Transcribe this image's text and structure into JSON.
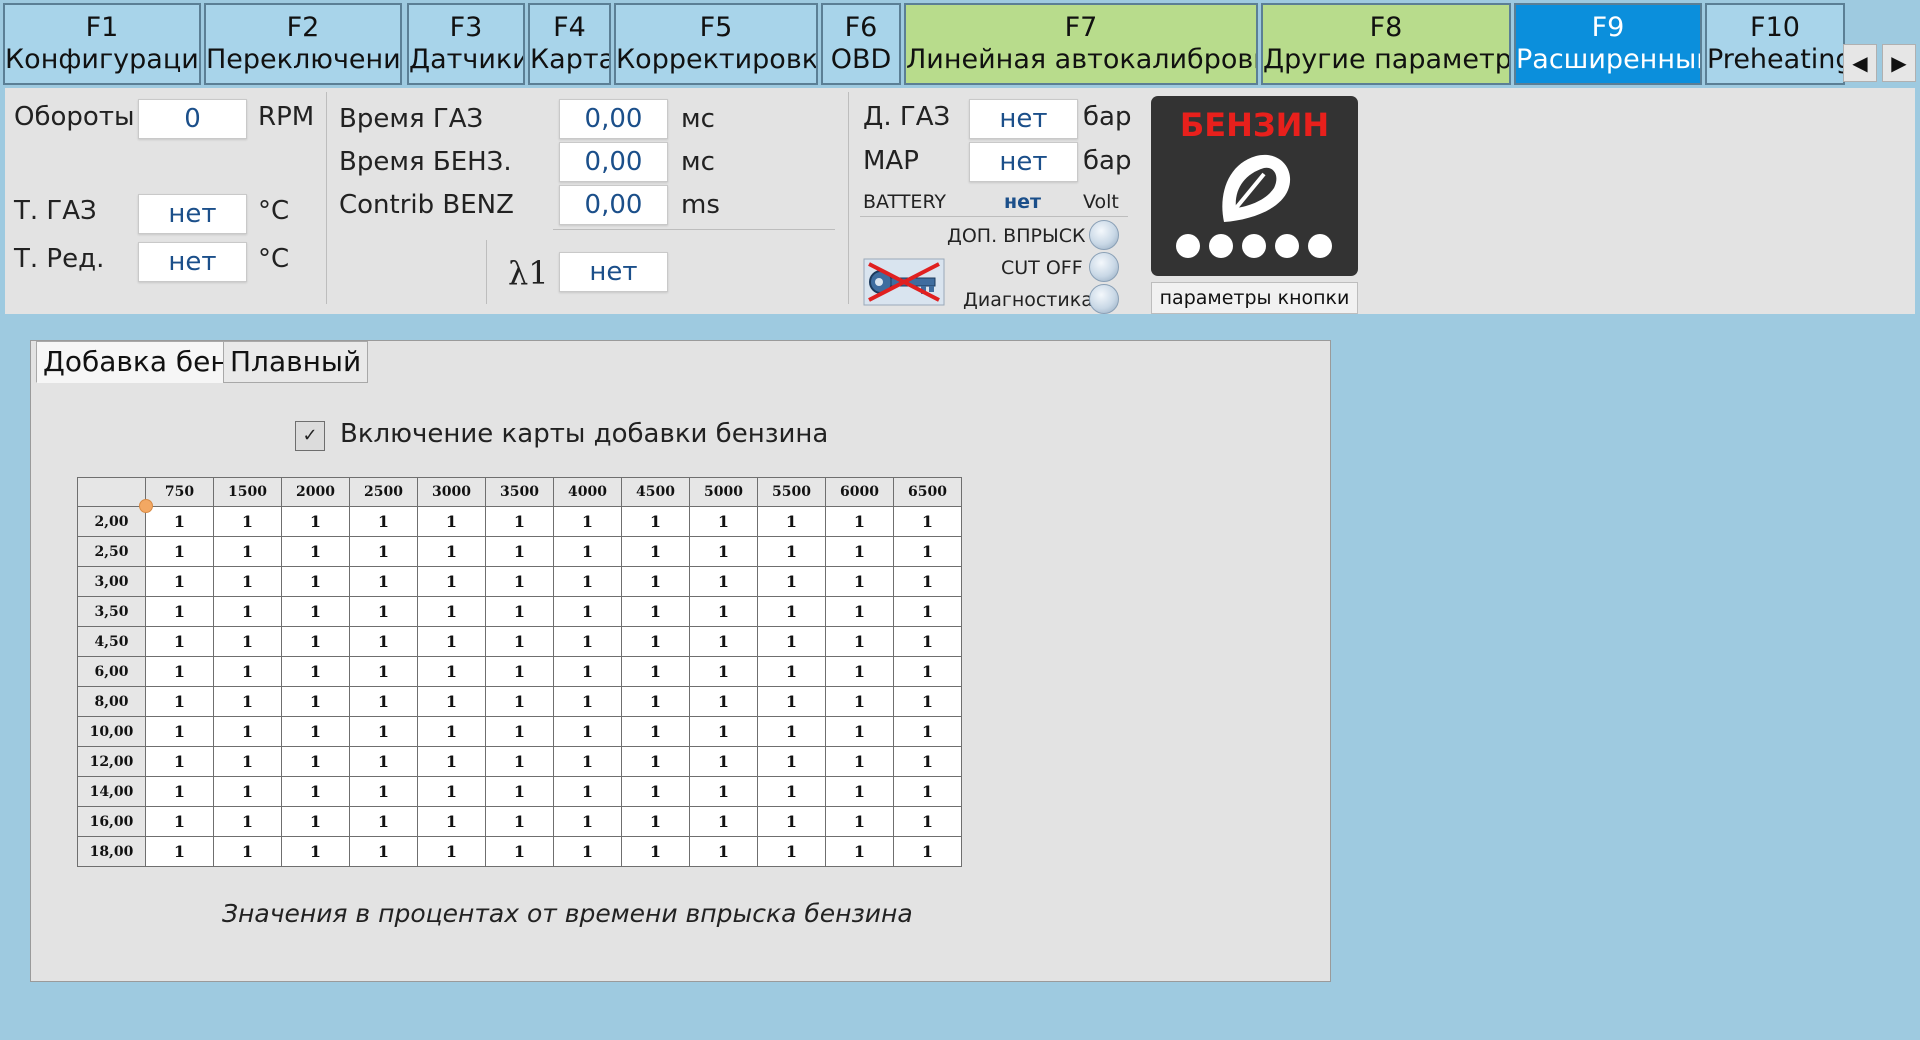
{
  "tabs": [
    {
      "key": "F1",
      "label": "Конфигурация"
    },
    {
      "key": "F2",
      "label": "Переключение"
    },
    {
      "key": "F3",
      "label": "Датчики"
    },
    {
      "key": "F4",
      "label": "Карта"
    },
    {
      "key": "F5",
      "label": "Корректировка"
    },
    {
      "key": "F6",
      "label": "OBD"
    },
    {
      "key": "F7",
      "label": "Линейная автокалибровка"
    },
    {
      "key": "F8",
      "label": "Другие параметры"
    },
    {
      "key": "F9",
      "label": "Расширенный"
    },
    {
      "key": "F10",
      "label": "Preheating"
    }
  ],
  "scroll": {
    "left": "◀",
    "right": "▶"
  },
  "status": {
    "rpm_label": "Обороты",
    "rpm_value": "0",
    "rpm_unit": "RPM",
    "tgas_label": "Т. ГАЗ",
    "tgas_value": "нет",
    "tgas_unit": "°C",
    "tred_label": "Т. Ред.",
    "tred_value": "нет",
    "tred_unit": "°C",
    "gas_time_label": "Время ГАЗ",
    "gas_time_value": "0,00",
    "gas_time_unit": "мс",
    "benz_time_label": "Время БЕНЗ.",
    "benz_time_value": "0,00",
    "benz_time_unit": "мс",
    "contrib_label": "Contrib BENZ",
    "contrib_value": "0,00",
    "contrib_unit": "ms",
    "lambda_label": "λ1",
    "lambda_value": "нет",
    "dgas_label": "Д. ГАЗ",
    "dgas_value": "нет",
    "dgas_unit": "бар",
    "map_label": "MAP",
    "map_value": "нет",
    "map_unit": "бар",
    "battery_label": "BATTERY",
    "battery_value": "нет",
    "battery_unit": "Volt",
    "extra_inj_label": "ДОП. ВПРЫСК",
    "cutoff_label": "CUT OFF",
    "diag_label": "Диагностика"
  },
  "fuel_button": {
    "title": "БЕНЗИН",
    "params_label": "параметры кнопки"
  },
  "subtabs": [
    "Добавка бенз",
    "Плавный"
  ],
  "map_enable": {
    "label": "Включение карты добавки бензина",
    "checked": true,
    "mark": "✓"
  },
  "grid": {
    "columns": [
      "750",
      "1500",
      "2000",
      "2500",
      "3000",
      "3500",
      "4000",
      "4500",
      "5000",
      "5500",
      "6000",
      "6500"
    ],
    "rows": [
      "2,00",
      "2,50",
      "3,00",
      "3,50",
      "4,50",
      "6,00",
      "8,00",
      "10,00",
      "12,00",
      "14,00",
      "16,00",
      "18,00"
    ],
    "cell_value": "1"
  },
  "note": "Значения в процентах от времени впрыска бензина",
  "colors": {
    "active_tab": "#0b8fdc",
    "green_tab": "#b8dc8c",
    "default_tab": "#a8d4ea",
    "background": "#9ecae0",
    "fuel_title": "#e8201c"
  }
}
